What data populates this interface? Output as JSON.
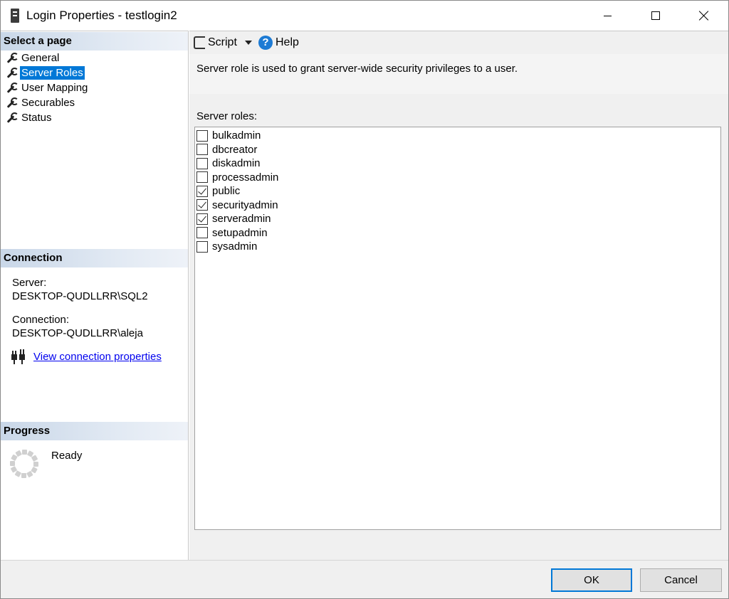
{
  "window": {
    "title": "Login Properties - testlogin2"
  },
  "left": {
    "select_page_header": "Select a page",
    "pages": [
      {
        "label": "General",
        "selected": false
      },
      {
        "label": "Server Roles",
        "selected": true
      },
      {
        "label": "User Mapping",
        "selected": false
      },
      {
        "label": "Securables",
        "selected": false
      },
      {
        "label": "Status",
        "selected": false
      }
    ],
    "connection_header": "Connection",
    "server_label": "Server:",
    "server_value": "DESKTOP-QUDLLRR\\SQL2",
    "connection_label": "Connection:",
    "connection_value": "DESKTOP-QUDLLRR\\aleja",
    "view_connection_link": "View connection properties",
    "progress_header": "Progress",
    "progress_status": "Ready"
  },
  "toolbar": {
    "script_label": "Script",
    "help_label": "Help"
  },
  "main": {
    "description": "Server role is used to grant server-wide security privileges to a user.",
    "roles_label": "Server roles:",
    "roles": [
      {
        "name": "bulkadmin",
        "checked": false
      },
      {
        "name": "dbcreator",
        "checked": false
      },
      {
        "name": "diskadmin",
        "checked": false
      },
      {
        "name": "processadmin",
        "checked": false
      },
      {
        "name": "public",
        "checked": true
      },
      {
        "name": "securityadmin",
        "checked": true
      },
      {
        "name": "serveradmin",
        "checked": true
      },
      {
        "name": "setupadmin",
        "checked": false
      },
      {
        "name": "sysadmin",
        "checked": false
      }
    ]
  },
  "footer": {
    "ok_label": "OK",
    "cancel_label": "Cancel"
  },
  "colors": {
    "selection": "#0078d7",
    "link": "#0000ee",
    "help_icon": "#1d7bd4"
  }
}
